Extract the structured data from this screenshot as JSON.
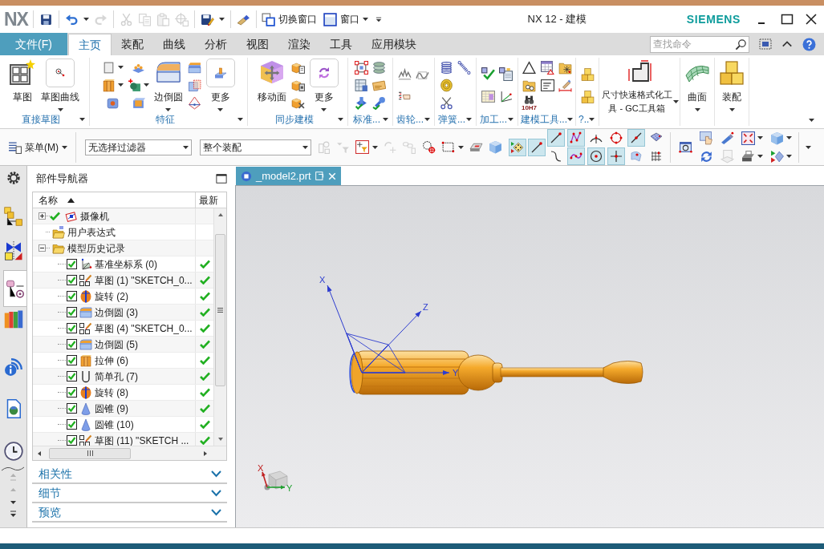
{
  "title_bar": {
    "logo": "NX",
    "quick_access": [
      {
        "tools": [
          {
            "kind": "save",
            "disabled": false
          }
        ]
      },
      {
        "tools": [
          {
            "kind": "undo",
            "disabled": false,
            "menu": true
          },
          {
            "kind": "redo",
            "disabled": true
          }
        ]
      },
      {
        "tools": [
          {
            "kind": "cut",
            "disabled": true
          },
          {
            "kind": "copy",
            "disabled": true
          },
          {
            "kind": "paste",
            "disabled": true
          },
          {
            "kind": "crosshair",
            "disabled": true
          }
        ]
      },
      {
        "tools": [
          {
            "kind": "save_as",
            "disabled": false,
            "menu": true
          }
        ]
      },
      {
        "tools": [
          {
            "kind": "brush",
            "disabled": false
          }
        ]
      }
    ],
    "switch_window": "切换窗口",
    "window_menu": "窗口",
    "title": "NX 12 - 建模",
    "brand": "SIEMENS"
  },
  "ribbon_tabs": [
    {
      "label": "文件(F)",
      "kind": "file",
      "selected": false
    },
    {
      "label": "主页",
      "kind": "tab",
      "selected": true
    },
    {
      "label": "装配",
      "kind": "tab",
      "selected": false
    },
    {
      "label": "曲线",
      "kind": "tab",
      "selected": false
    },
    {
      "label": "分析",
      "kind": "tab",
      "selected": false
    },
    {
      "label": "视图",
      "kind": "tab",
      "selected": false
    },
    {
      "label": "渲染",
      "kind": "tab",
      "selected": false
    },
    {
      "label": "工具",
      "kind": "tab",
      "selected": false
    },
    {
      "label": "应用模块",
      "kind": "tab",
      "selected": false
    }
  ],
  "command_search": {
    "placeholder": "查找命令"
  },
  "ribbon_groups": [
    {
      "kind": "direct_sketch",
      "label": "直接草图",
      "items": [
        {
          "kind": "sketch",
          "label": "草图",
          "menu": false
        },
        {
          "kind": "point_line",
          "label": "草图曲线",
          "menu": true
        }
      ]
    },
    {
      "kind": "feature",
      "label": "特征",
      "items": [
        {
          "kind": "column",
          "tools": [
            {
              "kind": "square",
              "menu": true
            },
            {
              "kind": "extrude",
              "menu": true
            },
            {
              "kind": "hole"
            }
          ]
        },
        {
          "kind": "column",
          "tools": [
            {
              "kind": "pattern"
            },
            {
              "kind": "unite",
              "menu": true
            },
            {
              "kind": "shell"
            }
          ]
        },
        {
          "kind": "blend",
          "label": "边倒圆",
          "menu": true
        },
        {
          "kind": "column",
          "tools": [
            {
              "kind": "chamfer"
            },
            {
              "kind": "box_frame"
            },
            {
              "kind": "draft"
            }
          ]
        },
        {
          "kind": "emboss",
          "label": "更多",
          "menu": true
        }
      ]
    },
    {
      "kind": "sync",
      "label": "同步建模",
      "items": [
        {
          "kind": "move_face",
          "label": "移动面",
          "menu": false
        },
        {
          "kind": "column",
          "tools": [
            {
              "kind": "face_offset"
            },
            {
              "kind": "face_replace"
            },
            {
              "kind": "face_delete"
            }
          ]
        },
        {
          "kind": "sync_more",
          "label": "更多",
          "menu": true
        }
      ]
    },
    {
      "kind": "standard",
      "label": "标准...",
      "items": [
        {
          "kind": "column",
          "tools": [
            {
              "kind": "frame_red"
            },
            {
              "kind": "table_doc"
            },
            {
              "kind": "fastener"
            }
          ]
        },
        {
          "kind": "column",
          "tools": [
            {
              "kind": "layers"
            },
            {
              "kind": "card"
            },
            {
              "kind": "wrench"
            }
          ]
        }
      ]
    },
    {
      "kind": "gear",
      "label": "齿轮...",
      "items": [
        {
          "kind": "pair",
          "tools": [
            {
              "kind": "gear_profile"
            },
            {
              "kind": "hand_list"
            }
          ]
        },
        {
          "kind": "pair",
          "tools": [
            {
              "kind": "gear_profile2"
            }
          ]
        }
      ]
    },
    {
      "kind": "spring",
      "label": "弹簧...",
      "items": [
        {
          "kind": "column",
          "tools": [
            {
              "kind": "spring"
            },
            {
              "kind": "coil"
            },
            {
              "kind": "scissors_spring"
            }
          ]
        },
        {
          "kind": "column",
          "tools": [
            {
              "kind": "extension_spring"
            }
          ]
        }
      ]
    },
    {
      "kind": "machining",
      "label": "加工...",
      "items": [
        {
          "kind": "pair",
          "tools": [
            {
              "kind": "check_part"
            },
            {
              "kind": "grid_table"
            }
          ]
        },
        {
          "kind": "pair",
          "tools": [
            {
              "kind": "part_doc"
            },
            {
              "kind": "axis"
            }
          ]
        }
      ]
    },
    {
      "kind": "modeling_tools",
      "label": "建模工具...",
      "items": [
        {
          "kind": "column",
          "tools": [
            {
              "kind": "triangle"
            },
            {
              "kind": "folder_group"
            },
            {
              "kind": "binoculars",
              "caption": "10H7"
            }
          ]
        },
        {
          "kind": "column",
          "tools": [
            {
              "kind": "table_red"
            },
            {
              "kind": "note"
            }
          ]
        },
        {
          "kind": "column",
          "tools": [
            {
              "kind": "folder_spark"
            },
            {
              "kind": "dimension"
            }
          ]
        }
      ]
    },
    {
      "kind": "misc",
      "label": "?..",
      "items": [
        {
          "kind": "pair",
          "tools": [
            {
              "kind": "blocks"
            },
            {
              "kind": "blocks"
            }
          ]
        }
      ]
    },
    {
      "kind": "gc",
      "items": [
        {
          "kind": "l_profile",
          "label": "尺寸快速格式化工具 - GC工具箱",
          "menu": true
        }
      ]
    },
    {
      "kind": "surface",
      "items": [
        {
          "kind": "surface",
          "label": "曲面",
          "menu": true
        }
      ]
    },
    {
      "kind": "assembly",
      "items": [
        {
          "kind": "blocks",
          "label": "装配",
          "menu": true
        }
      ]
    }
  ],
  "selection_bar": {
    "menu": "菜单(M)",
    "filter": "无选择过滤器",
    "scope": "整个装配",
    "tools": [
      {
        "kind": "assembly",
        "disabled": true
      },
      {
        "kind": "filter",
        "disabled": true
      },
      {
        "kind": "point_filter",
        "disabled": false,
        "menu": true
      },
      {
        "kind": "rotate",
        "disabled": true
      },
      {
        "kind": "chain",
        "disabled": true
      },
      {
        "kind": "lasso",
        "disabled": false
      },
      {
        "kind": "rect_select",
        "disabled": false,
        "menu": true
      },
      {
        "kind": "eraser",
        "disabled": false
      },
      {
        "kind": "cube",
        "disabled": false
      }
    ],
    "snap_tools": [
      {
        "kind": "snap",
        "selected": true
      },
      {
        "kind": "line_end",
        "selected": true
      },
      {
        "kind": "line_end",
        "selected": true
      },
      {
        "kind": "curve",
        "selected": false
      },
      {
        "kind": "ctrl_points",
        "selected": true
      },
      {
        "kind": "wave",
        "selected": true
      },
      {
        "kind": "arc_center",
        "selected": false
      },
      {
        "kind": "circle_center",
        "selected": true
      },
      {
        "kind": "quadrant",
        "selected": false
      },
      {
        "kind": "point_plus",
        "selected": true
      },
      {
        "kind": "line_mid",
        "selected": true
      },
      {
        "kind": "surface_point",
        "selected": false
      },
      {
        "kind": "face_grid",
        "selected": false
      },
      {
        "kind": "grid_points",
        "selected": false
      }
    ],
    "view_tools": [
      {
        "kind": "fit",
        "disabled": false
      },
      {
        "kind": "hand",
        "disabled": false
      },
      {
        "kind": "refresh",
        "disabled": false
      },
      {
        "kind": "pencil",
        "disabled": false
      },
      {
        "kind": "doc",
        "disabled": true
      },
      {
        "kind": "expand",
        "disabled": false,
        "menu": true
      },
      {
        "kind": "printer",
        "disabled": false,
        "menu": true
      },
      {
        "kind": "cube",
        "disabled": false,
        "menu": true
      },
      {
        "kind": "play",
        "disabled": false,
        "menu": true
      }
    ]
  },
  "resource_bar": [
    {
      "kind": "settings",
      "selected": false
    },
    {
      "kind": "assembly_navigator",
      "selected": false
    },
    {
      "kind": "constraint_navigator",
      "selected": false
    },
    {
      "kind": "part_navigator",
      "selected": true
    },
    {
      "kind": "reuse_library",
      "selected": false
    },
    {
      "kind": "info",
      "selected": false
    },
    {
      "kind": "web",
      "selected": false
    },
    {
      "kind": "history",
      "selected": false
    }
  ],
  "part_navigator": {
    "title": "部件导航器",
    "columns": [
      {
        "label": "名称",
        "sorted": true
      },
      {
        "label": "最新"
      }
    ],
    "tree": [
      {
        "label": "摄像机",
        "kind": "camera",
        "expanded": false,
        "checked": true
      },
      {
        "label": "用户表达式",
        "kind": "expressions"
      },
      {
        "label": "模型历史记录",
        "kind": "history",
        "expanded": true,
        "children": [
          {
            "label": "基准坐标系 (0)",
            "kind": "datum_csys",
            "checked": true,
            "latest": true
          },
          {
            "label": "草图 (1) \"SKETCH_0...",
            "kind": "sketch",
            "checked": true,
            "latest": true
          },
          {
            "label": "旋转 (2)",
            "kind": "revolve",
            "checked": true,
            "latest": true
          },
          {
            "label": "边倒圆 (3)",
            "kind": "edge_blend",
            "checked": true,
            "latest": true
          },
          {
            "label": "草图 (4) \"SKETCH_0...",
            "kind": "sketch",
            "checked": true,
            "latest": true
          },
          {
            "label": "边倒圆 (5)",
            "kind": "edge_blend",
            "checked": true,
            "latest": true
          },
          {
            "label": "拉伸 (6)",
            "kind": "extrude",
            "checked": true,
            "latest": true
          },
          {
            "label": "简单孔 (7)",
            "kind": "simple_hole",
            "checked": true,
            "latest": true
          },
          {
            "label": "旋转 (8)",
            "kind": "revolve",
            "checked": true,
            "latest": true
          },
          {
            "label": "圆锥 (9)",
            "kind": "cone",
            "checked": true,
            "latest": true
          },
          {
            "label": "圆锥 (10)",
            "kind": "cone",
            "checked": true,
            "latest": true
          },
          {
            "label": "草图 (11) \"SKETCH ...",
            "kind": "sketch",
            "checked": true,
            "latest": true
          }
        ]
      }
    ],
    "sections": [
      {
        "label": "相关性",
        "expanded": false
      },
      {
        "label": "细节",
        "expanded": false
      },
      {
        "label": "预览",
        "expanded": false
      }
    ]
  },
  "viewport": {
    "tab": {
      "label": "_model2.prt",
      "selected": true
    },
    "csys_labels": [
      "X",
      "Z",
      "Y"
    ],
    "triad_labels": [
      "X",
      "Y"
    ]
  }
}
